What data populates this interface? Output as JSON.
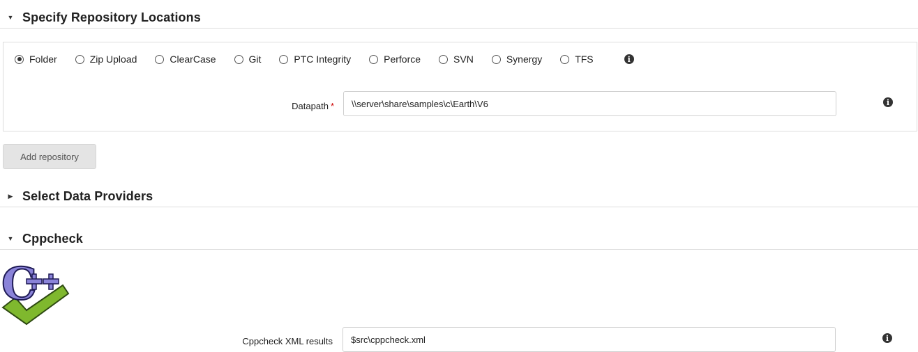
{
  "sections": {
    "repository": {
      "title": "Specify Repository Locations",
      "expanded": true
    },
    "providers": {
      "title": "Select Data Providers",
      "expanded": false
    },
    "cppcheck": {
      "title": "Cppcheck",
      "expanded": true
    }
  },
  "repository": {
    "options": [
      "Folder",
      "Zip Upload",
      "ClearCase",
      "Git",
      "PTC Integrity",
      "Perforce",
      "SVN",
      "Synergy",
      "TFS"
    ],
    "selected": "Folder",
    "datapath_label": "Datapath",
    "required_mark": "*",
    "datapath_value": "\\\\server\\share\\samples\\c\\Earth\\V6"
  },
  "add_repository_label": "Add repository",
  "cppcheck": {
    "logo_text": "C++",
    "xml_label": "Cppcheck XML results",
    "xml_value": "$src\\cppcheck.xml"
  },
  "icons": {
    "expanded_caret": "caret-down-icon",
    "collapsed_caret": "caret-right-icon",
    "info": "info-icon",
    "info_glyph": "i"
  },
  "colors": {
    "required": "#cc0000",
    "logo_purple": "#8a83d9",
    "logo_green": "#7fb82e"
  }
}
